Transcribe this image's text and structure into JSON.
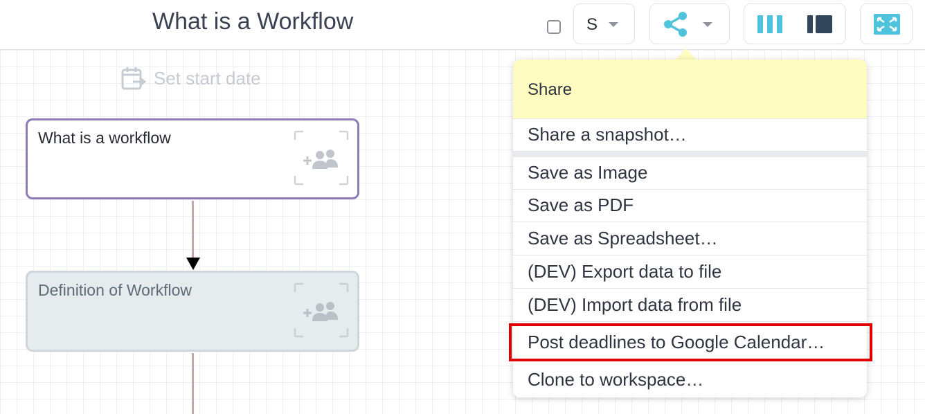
{
  "header": {
    "title": "What is a Workflow",
    "size_selector_label": "S",
    "icons": [
      "checkbox",
      "chevron-down-icon",
      "share-icon",
      "columns-view-icon",
      "sidebar-view-icon",
      "fit-screen-icon"
    ],
    "colors": {
      "accent": "#4fc3dc",
      "dark_icon": "#33475b"
    }
  },
  "canvas": {
    "start_date_label": "Set start date",
    "nodes": [
      {
        "title": "What is a workflow",
        "border_color": "#8e7bb8",
        "background": "#ffffff"
      },
      {
        "title": "Definition of Workflow",
        "border_color": "#cfd6da",
        "background": "#e6ebed"
      }
    ],
    "connector_color": "#c7a8a8"
  },
  "share_menu": {
    "header": "Share",
    "header_color": "#fefcc0",
    "items": [
      "Share a snapshot…",
      "Save as Image",
      "Save as PDF",
      "Save as Spreadsheet…",
      "(DEV) Export data to file",
      "(DEV) Import data from file",
      "Post deadlines to Google Calendar…",
      "Clone to workspace…"
    ],
    "highlight_color": "#e00000"
  }
}
